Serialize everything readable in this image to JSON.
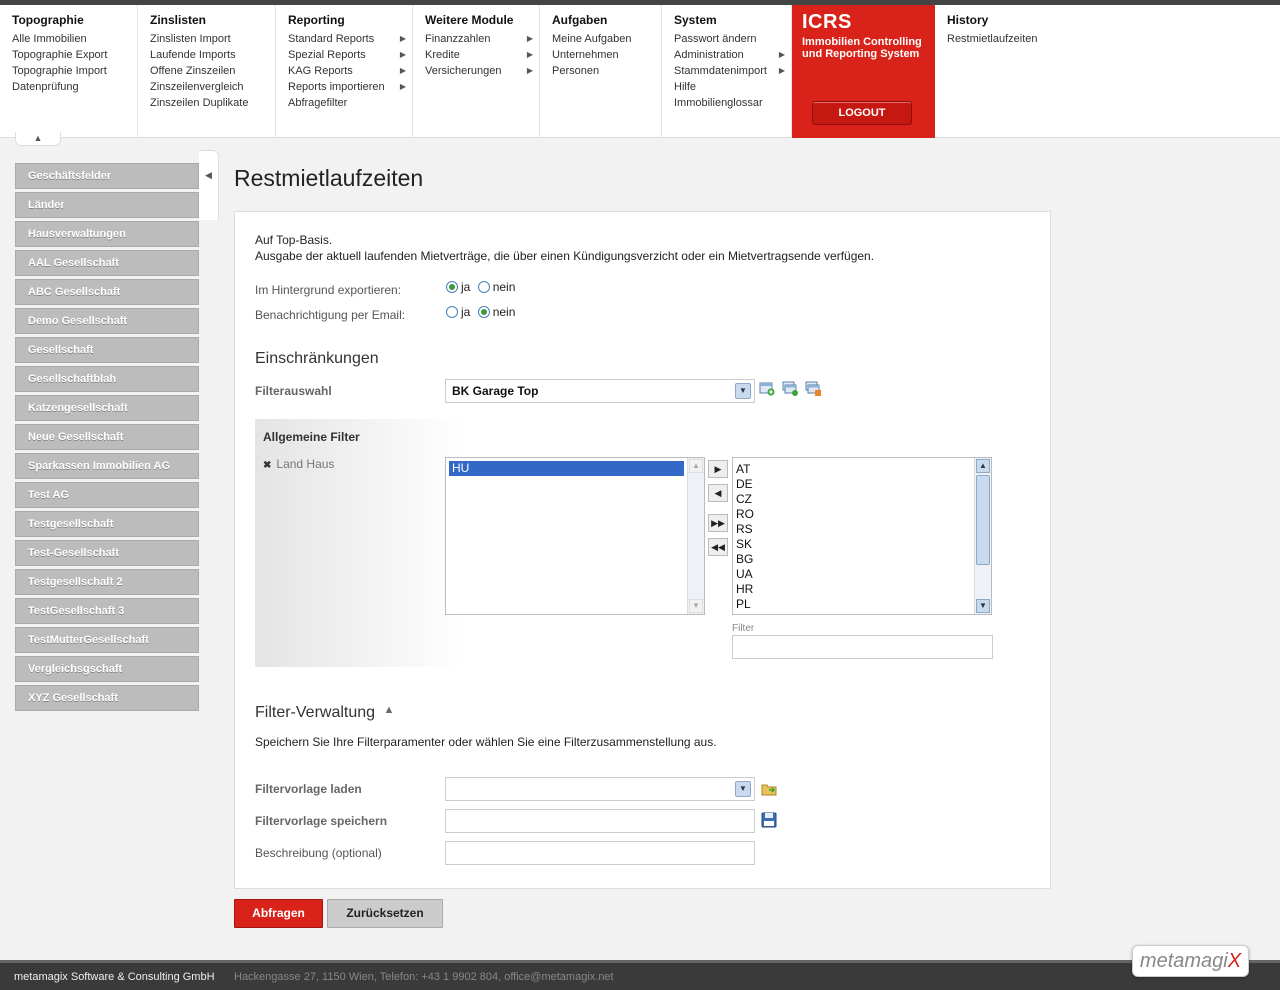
{
  "menu": {
    "cols": [
      {
        "title": "Topographie",
        "items": [
          "Alle Immobilien",
          "Topographie Export",
          "Topographie Import",
          "Datenprüfung"
        ],
        "arrows": [
          false,
          false,
          false,
          false
        ]
      },
      {
        "title": "Zinslisten",
        "items": [
          "Zinslisten Import",
          "Laufende Imports",
          "Offene Zinszeilen",
          "Zinszeilenvergleich",
          "Zinszeilen Duplikate"
        ],
        "arrows": [
          false,
          false,
          false,
          false,
          false
        ]
      },
      {
        "title": "Reporting",
        "items": [
          "Standard Reports",
          "Spezial Reports",
          "KAG Reports",
          "Reports importieren",
          "Abfragefilter"
        ],
        "arrows": [
          true,
          true,
          true,
          true,
          false
        ]
      },
      {
        "title": "Weitere Module",
        "items": [
          "Finanzzahlen",
          "Kredite",
          "Versicherungen"
        ],
        "arrows": [
          true,
          true,
          true
        ]
      },
      {
        "title": "Aufgaben",
        "items": [
          "Meine Aufgaben",
          "Unternehmen",
          "Personen"
        ],
        "arrows": [
          false,
          false,
          false
        ]
      },
      {
        "title": "System",
        "items": [
          "Passwort ändern",
          "Administration",
          "Stammdatenimport",
          "Hilfe",
          "Immobilienglossar"
        ],
        "arrows": [
          false,
          true,
          true,
          false,
          false
        ]
      }
    ],
    "icrs_title": "ICRS",
    "icrs_sub": "Immobilien Controlling und Reporting System",
    "logout": "LOGOUT",
    "history_title": "History",
    "history_item": "Restmietlaufzeiten"
  },
  "sidebar": {
    "items": [
      "Geschäftsfelder",
      "Länder",
      "Hausverwaltungen",
      "AAL Gesellschaft",
      "ABC Gesellschaft",
      "Demo Gesellschaft",
      "Gesellschaft",
      "Gesellschaftblah",
      "Katzengesellschaft",
      "Neue Gesellschaft",
      "Sparkassen Immobilien AG",
      "Test AG",
      "Testgesellschaft",
      "Test-Gesellschaft",
      "Testgesellschaft 2",
      "TestGesellschaft 3",
      "TestMutterGesellschaft",
      "Vergleichsgschaft",
      "XYZ Gesellschaft"
    ]
  },
  "page": {
    "title": "Restmietlaufzeiten",
    "desc_line1": "Auf Top-Basis.",
    "desc_line2": "Ausgabe der aktuell laufenden Mietverträge, die über einen Kündigungsverzicht oder ein Mietvertragsende verfügen.",
    "bg_export_label": "Im Hintergrund exportieren:",
    "email_label": "Benachrichtigung per Email:",
    "yes": "ja",
    "no": "nein",
    "bg_export_value": "ja",
    "email_value": "nein"
  },
  "restrictions": {
    "heading": "Einschränkungen",
    "filter_label": "Filterauswahl",
    "filter_value": "BK Garage Top",
    "general_filter": "Allgemeine Filter",
    "filter_item": "Land Haus",
    "selected": [
      "HU"
    ],
    "available": [
      "AT",
      "DE",
      "CZ",
      "RO",
      "RS",
      "SK",
      "BG",
      "UA",
      "HR",
      "PL"
    ],
    "filter_small_label": "Filter"
  },
  "filter_mgmt": {
    "heading": "Filter-Verwaltung",
    "desc": "Speichern Sie Ihre Filterparamenter oder wählen Sie eine Filterzusammenstellung aus.",
    "load_label": "Filtervorlage laden",
    "save_label": "Filtervorlage speichern",
    "desc_label": "Beschreibung (optional)"
  },
  "buttons": {
    "submit": "Abfragen",
    "reset": "Zurücksetzen"
  },
  "footer": {
    "company": "metamagix Software & Consulting GmbH",
    "address": "Hackengasse 27, 1150 Wien, Telefon: +43 1 9902 804, office@metamagix.net",
    "logo_text": "metamagi",
    "logo_x": "X"
  },
  "colors": {
    "accent": "#d8221a",
    "selection": "#3368c6"
  }
}
